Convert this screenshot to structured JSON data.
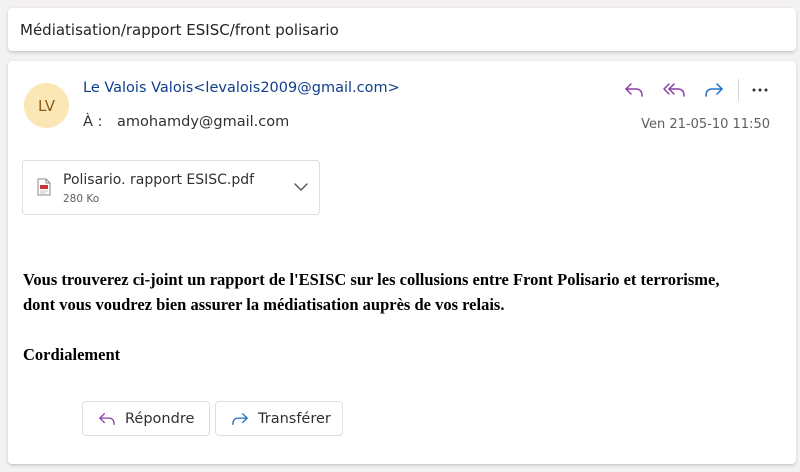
{
  "subject": "Médiatisation/rapport ESISC/front polisario",
  "message": {
    "avatar_initials": "LV",
    "sender": "Le Valois Valois<levalois2009@gmail.com>",
    "to_label": "À :",
    "to_address": "amohamdy@gmail.com",
    "date": "Ven 21-05-10 11:50",
    "attachment": {
      "name": "Polisario. rapport ESISC.pdf",
      "size": "280 Ko"
    },
    "body": {
      "line1": "Vous trouverez ci-joint un rapport de l'ESISC sur les collusions entre Front Polisario et terrorisme, dont vous voudrez bien assurer la médiatisation auprès de vos relais.",
      "signoff": "Cordialement"
    },
    "buttons": {
      "reply": "Répondre",
      "forward": "Transférer"
    }
  },
  "colors": {
    "accent_purple": "#8b3fa7",
    "accent_blue": "#1f6fc5",
    "sender_link": "#0f3e8c",
    "avatar_bg": "#fbe6b5"
  },
  "icons": [
    "reply-icon",
    "reply-all-icon",
    "forward-icon",
    "more-icon",
    "pdf-file-icon",
    "chevron-down-icon"
  ]
}
